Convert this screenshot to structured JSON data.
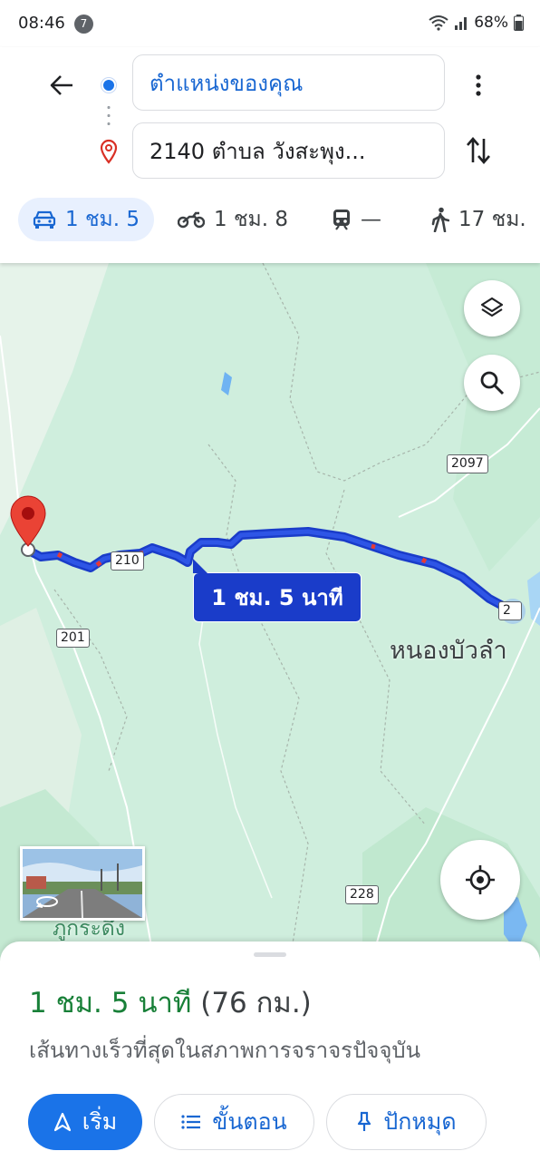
{
  "status_bar": {
    "time": "08:46",
    "notification_count": "7",
    "battery": "68%"
  },
  "directions": {
    "origin": "ตำแหน่งของคุณ",
    "destination": "2140 ตำบล วังสะพุง...",
    "modes": [
      {
        "name": "drive",
        "label": "1 ชม. 5",
        "active": true
      },
      {
        "name": "motorcycle",
        "label": "1 ชม. 8",
        "active": false
      },
      {
        "name": "transit",
        "label": "—",
        "active": false
      },
      {
        "name": "walk",
        "label": "17 ชม.",
        "active": false
      }
    ]
  },
  "map": {
    "route_label": "1 ชม. 5 นาที",
    "place_label": "หนองบัวลำ",
    "partial_place_text": "ิ",
    "partial_place_text2": "ภูกระดึง",
    "road_signs": [
      "2097",
      "210",
      "201",
      "228",
      "2"
    ]
  },
  "summary": {
    "time": "1 ชม. 5 นาที",
    "distance": "(76 กม.)",
    "description": "เส้นทางเร็วที่สุดในสภาพการจราจรปัจจุบัน"
  },
  "actions": {
    "start": "เริ่ม",
    "steps": "ขั้นตอน",
    "pin": "ปักหมุด"
  },
  "colors": {
    "route": "#1a3cc9",
    "accent": "#1a73e8",
    "eta_green": "#188038",
    "map_bg": "#cfeedd"
  }
}
